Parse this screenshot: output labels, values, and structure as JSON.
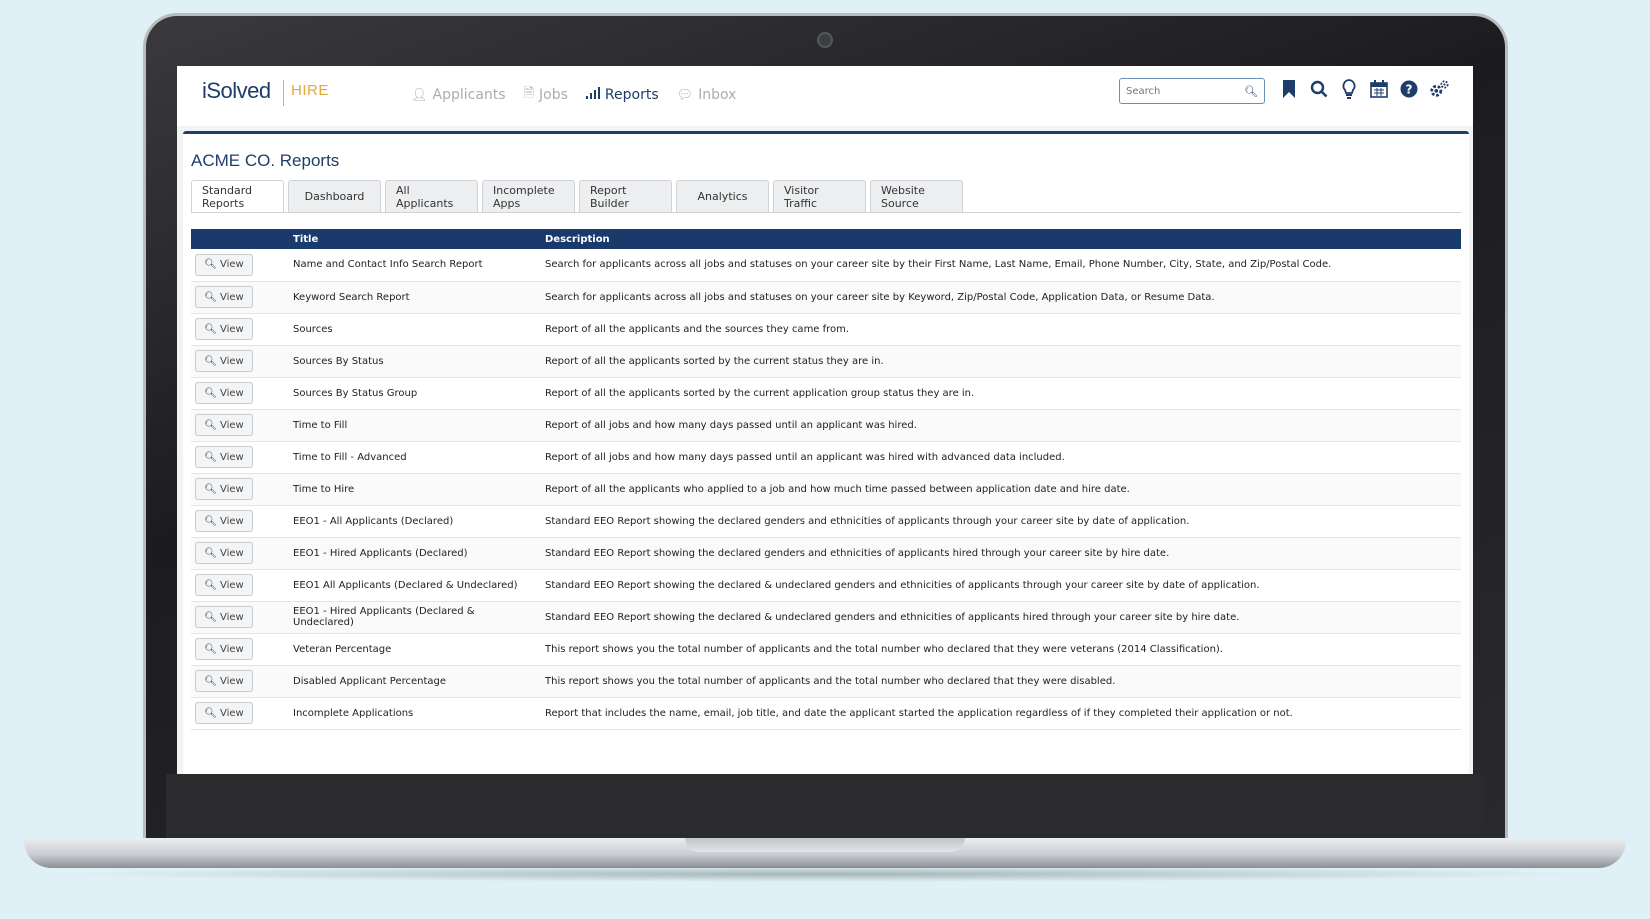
{
  "app": {
    "logo": "iSolved",
    "logo_sub": "HIRE"
  },
  "nav": {
    "items": [
      {
        "label": "Applicants",
        "icon": "user-icon"
      },
      {
        "label": "Jobs",
        "icon": "document-icon"
      },
      {
        "label": "Reports",
        "icon": "bar-chart-icon"
      },
      {
        "label": "Inbox",
        "icon": "chat-icon"
      }
    ],
    "active": "Reports"
  },
  "search": {
    "placeholder": "Search"
  },
  "tools": [
    "bookmark-icon",
    "search-icon",
    "lightbulb-icon",
    "calendar-icon",
    "help-icon",
    "settings-icon"
  ],
  "page": {
    "title": "ACME CO. Reports"
  },
  "tabs": [
    {
      "label": "Standard Reports",
      "active": true
    },
    {
      "label": "Dashboard"
    },
    {
      "label": "All Applicants"
    },
    {
      "label": "Incomplete Apps"
    },
    {
      "label": "Report Builder"
    },
    {
      "label": "Analytics"
    },
    {
      "label": "Visitor Traffic"
    },
    {
      "label": "Website Source"
    }
  ],
  "table": {
    "headers": {
      "title": "Title",
      "description": "Description"
    },
    "view_label": "View",
    "rows": [
      {
        "title": "Name and Contact Info Search Report",
        "description": "Search for applicants across all jobs and statuses on your career site by their First Name, Last Name, Email, Phone Number, City, State, and Zip/Postal Code."
      },
      {
        "title": "Keyword Search Report",
        "description": "Search for applicants across all jobs and statuses on your career site by Keyword, Zip/Postal Code, Application Data, or Resume Data."
      },
      {
        "title": "Sources",
        "description": "Report of all the applicants and the sources they came from."
      },
      {
        "title": "Sources By Status",
        "description": "Report of all the applicants sorted by the current status they are in."
      },
      {
        "title": "Sources By Status Group",
        "description": "Report of all the applicants sorted by the current application group status they are in."
      },
      {
        "title": "Time to Fill",
        "description": "Report of all jobs and how many days passed until an applicant was hired."
      },
      {
        "title": "Time to Fill - Advanced",
        "description": "Report of all jobs and how many days passed until an applicant was hired with advanced data included."
      },
      {
        "title": "Time to Hire",
        "description": "Report of all the applicants who applied to a job and how much time passed between application date and hire date."
      },
      {
        "title": "EEO1 - All Applicants (Declared)",
        "description": "Standard EEO Report showing the declared genders and ethnicities of applicants through your career site by date of application."
      },
      {
        "title": "EEO1 - Hired Applicants (Declared)",
        "description": "Standard EEO Report showing the declared genders and ethnicities of applicants hired through your career site by hire date."
      },
      {
        "title": "EEO1 All Applicants (Declared & Undeclared)",
        "description": "Standard EEO Report showing the declared & undeclared genders and ethnicities of applicants through your career site by date of application."
      },
      {
        "title": "EEO1 - Hired Applicants (Declared & Undeclared)",
        "description": "Standard EEO Report showing the declared & undeclared genders and ethnicities of applicants hired through your career site by hire date."
      },
      {
        "title": "Veteran Percentage",
        "description": "This report shows you the total number of applicants and the total number who declared that they were veterans (2014 Classification)."
      },
      {
        "title": "Disabled Applicant Percentage",
        "description": "This report shows you the total number of applicants and the total number who declared that they were disabled."
      },
      {
        "title": "Incomplete Applications",
        "description": "Report that includes the name, email, job title, and date the applicant started the application regardless of if they completed their application or not."
      }
    ]
  },
  "colors": {
    "brand": "#1f3d6b",
    "accent": "#e3a83a",
    "header_bg": "#1a3a6b",
    "background": "#dff1f6"
  }
}
